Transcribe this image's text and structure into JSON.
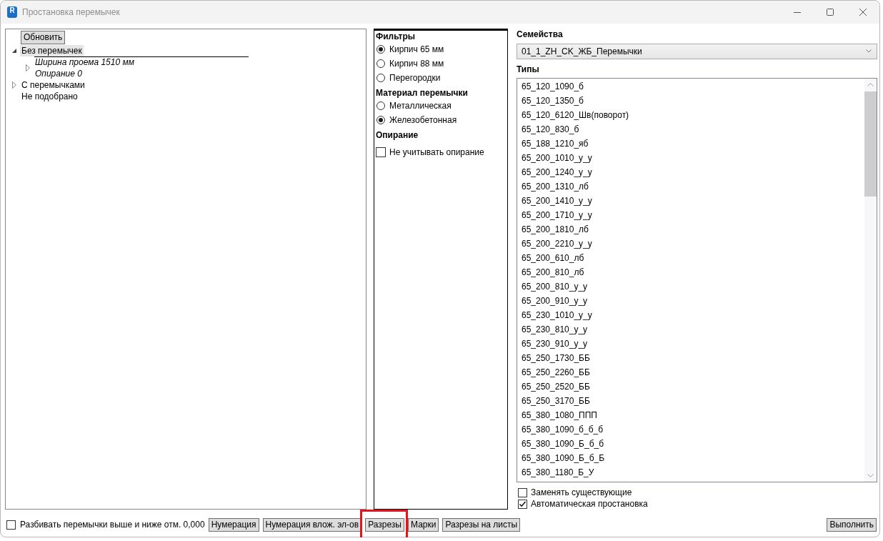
{
  "window": {
    "title": "Простановка перемычек",
    "icon_letter": "R"
  },
  "tree": {
    "refresh_button": "Обновить",
    "items": [
      {
        "label": "Без перемычек",
        "selected": true,
        "expandable": true,
        "expanded": true,
        "children": [
          {
            "label": "Ширина проема 1510 мм",
            "detail": "Опирание 0",
            "selected": false,
            "expandable": true,
            "expanded": false
          }
        ]
      },
      {
        "label": "С перемычками",
        "selected": false,
        "expandable": true,
        "expanded": false
      },
      {
        "label": "Не подобрано",
        "selected": false,
        "expandable": false
      }
    ]
  },
  "filters": {
    "sections": [
      {
        "heading": "Фильтры",
        "options": [
          {
            "kind": "radio",
            "label": "Кирпич 65 мм",
            "selected": true
          },
          {
            "kind": "radio",
            "label": "Кирпич 88 мм",
            "selected": false
          },
          {
            "kind": "radio",
            "label": "Перегородки",
            "selected": false
          }
        ]
      },
      {
        "heading": "Материал перемычки",
        "options": [
          {
            "kind": "radio",
            "label": "Металлическая",
            "selected": false
          },
          {
            "kind": "radio",
            "label": "Железобетонная",
            "selected": true
          }
        ]
      },
      {
        "heading": "Опирание",
        "options": [
          {
            "kind": "checkbox",
            "label": "Не учитывать опирание",
            "checked": false
          }
        ]
      }
    ]
  },
  "families": {
    "label": "Семейства",
    "value": "01_1_ZH_CK_ЖБ_Перемычки"
  },
  "types": {
    "label": "Типы",
    "items": [
      {
        "label": "65_120_1090_б",
        "selected": false
      },
      {
        "label": "65_120_1350_б",
        "selected": false
      },
      {
        "label": "65_120_6120_Шв(поворот)",
        "selected": false
      },
      {
        "label": "65_120_830_б",
        "selected": false
      },
      {
        "label": "65_188_1210_яб",
        "selected": false
      },
      {
        "label": "65_200_1010_у_у",
        "selected": false
      },
      {
        "label": "65_200_1240_у_у",
        "selected": false
      },
      {
        "label": "65_200_1310_лб",
        "selected": false
      },
      {
        "label": "65_200_1410_у_у",
        "selected": false
      },
      {
        "label": "65_200_1710_у_у",
        "selected": false
      },
      {
        "label": "65_200_1810_лб",
        "selected": false
      },
      {
        "label": "65_200_2210_у_у",
        "selected": false
      },
      {
        "label": "65_200_610_лб",
        "selected": false
      },
      {
        "label": "65_200_810_лб",
        "selected": false
      },
      {
        "label": "65_200_810_у_у",
        "selected": false
      },
      {
        "label": "65_200_910_у_у",
        "selected": false
      },
      {
        "label": "65_230_1010_у_у",
        "selected": false
      },
      {
        "label": "65_230_810_у_у",
        "selected": false
      },
      {
        "label": "65_230_910_у_у",
        "selected": false
      },
      {
        "label": "65_250_1730_ББ",
        "selected": false
      },
      {
        "label": "65_250_2260_ББ",
        "selected": false
      },
      {
        "label": "65_250_2520_ББ",
        "selected": false
      },
      {
        "label": "65_250_3170_ББ",
        "selected": false
      },
      {
        "label": "65_380_1080_ППП",
        "selected": false
      },
      {
        "label": "65_380_1090_б_б_б",
        "selected": false
      },
      {
        "label": "65_380_1090_Б_б_б",
        "selected": false
      },
      {
        "label": "65_380_1090_Б_б_Б",
        "selected": false
      },
      {
        "label": "65_380_1180_Б_У",
        "selected": false
      }
    ]
  },
  "type_options": [
    {
      "label": "Заменять существующие",
      "checked": false
    },
    {
      "label": "Автоматическая простановка",
      "checked": true
    }
  ],
  "footer": {
    "split_option": {
      "label": "Разбивать перемычки выше и ниже отм. 0,000",
      "checked": false
    },
    "buttons": [
      {
        "label": "Нумерация",
        "highlighted": false
      },
      {
        "label": "Нумерация влож. эл-ов",
        "highlighted": false
      },
      {
        "label": "Разрезы",
        "highlighted": true
      },
      {
        "label": "Марки",
        "highlighted": false
      },
      {
        "label": "Разрезы на листы",
        "highlighted": false
      }
    ],
    "run_button": "Выполнить"
  }
}
